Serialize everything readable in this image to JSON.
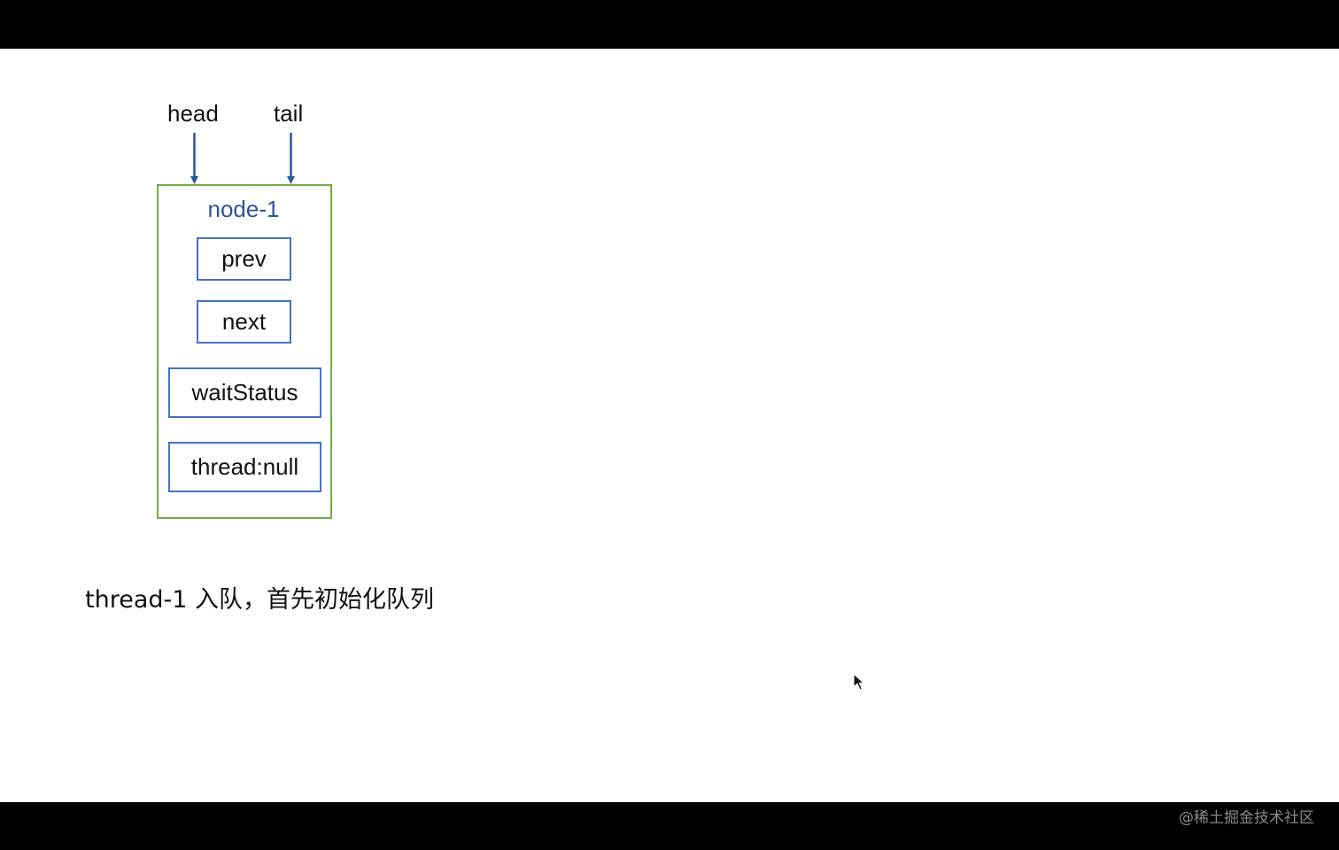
{
  "diagram": {
    "pointers": {
      "head": "head",
      "tail": "tail"
    },
    "node": {
      "title": "node-1",
      "fields": {
        "prev": "prev",
        "next": "next",
        "wait_status": "waitStatus",
        "thread": "thread:null"
      }
    },
    "caption": "thread-1 入队，首先初始化队列"
  },
  "watermark": "@稀土掘金技术社区",
  "colors": {
    "node_border": "#70ad47",
    "field_border": "#4472c4",
    "title_text": "#2f5597",
    "arrow": "#2f5597"
  }
}
